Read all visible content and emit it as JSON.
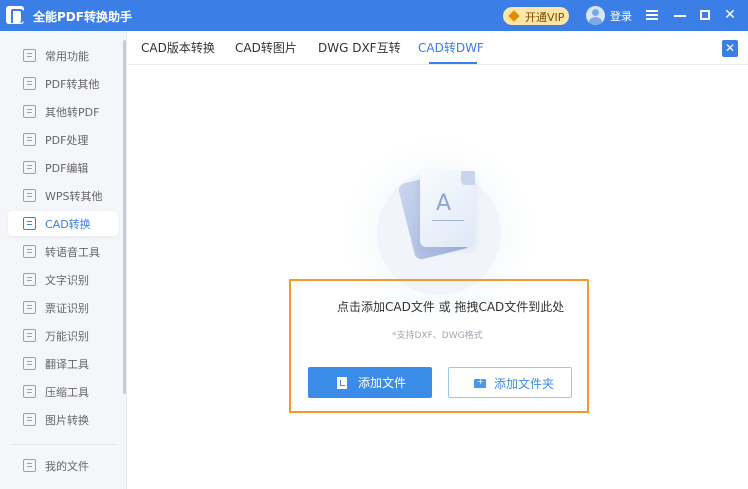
{
  "app": {
    "title": "全能PDF转换助手",
    "vip_label": "开通VIP",
    "login_label": "登录",
    "colors": {
      "brand": "#3b7fe6",
      "drop_highlight": "#f29b2d",
      "vip_background": "#ffe6a8"
    }
  },
  "window_controls": [
    {
      "name": "menu-icon",
      "label": ""
    },
    {
      "name": "minimize-icon",
      "label": ""
    },
    {
      "name": "maximize-icon",
      "label": ""
    },
    {
      "name": "close-icon",
      "label": "✕"
    }
  ],
  "sidebar": {
    "items": [
      {
        "label": "常用功能",
        "icon": "star-icon"
      },
      {
        "label": "PDF转其他",
        "icon": "pdf-export-icon"
      },
      {
        "label": "其他转PDF",
        "icon": "pdf-import-icon"
      },
      {
        "label": "PDF处理",
        "icon": "pdf-process-icon"
      },
      {
        "label": "PDF编辑",
        "icon": "pdf-edit-icon"
      },
      {
        "label": "WPS转其他",
        "icon": "wps-icon"
      },
      {
        "label": "CAD转换",
        "icon": "cad-icon",
        "active": true
      },
      {
        "label": "转语音工具",
        "icon": "audio-icon"
      },
      {
        "label": "文字识别",
        "icon": "text-recognition-icon"
      },
      {
        "label": "票证识别",
        "icon": "ticket-recognition-icon"
      },
      {
        "label": "万能识别",
        "icon": "universal-recognition-icon"
      },
      {
        "label": "翻译工具",
        "icon": "translate-icon"
      },
      {
        "label": "压缩工具",
        "icon": "compress-icon"
      },
      {
        "label": "图片转换",
        "icon": "image-convert-icon"
      }
    ],
    "footer_item": {
      "label": "我的文件",
      "icon": "folder-icon"
    }
  },
  "tabs": [
    {
      "label": "CAD版本转换"
    },
    {
      "label": "CAD转图片"
    },
    {
      "label": "DWG DXF互转"
    },
    {
      "label": "CAD转DWF",
      "active": true
    }
  ],
  "panel_close": "✕",
  "main": {
    "file_icon_letter": "A",
    "drop_zone": {
      "title": "点击添加CAD文件 或 拖拽CAD文件到此处",
      "subtitle": "*支持DXF、DWG格式"
    },
    "buttons": {
      "add_file": "添加文件",
      "add_folder": "添加文件夹"
    }
  }
}
